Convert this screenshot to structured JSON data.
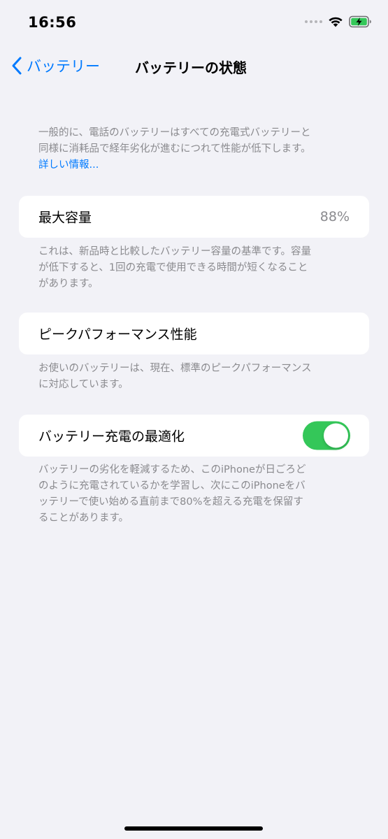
{
  "status_bar": {
    "time": "16:56",
    "battery_color": "#34c759"
  },
  "nav": {
    "back_label": "バッテリー",
    "title": "バッテリーの状態"
  },
  "intro": {
    "text_line1": "一般的に、電話のバッテリーはすべての充電式バッテリーと",
    "text_line2": "同様に消耗品で経年劣化が進むにつれて性能が低下します。",
    "link": "詳しい情報..."
  },
  "max_capacity": {
    "label": "最大容量",
    "value": "88%",
    "footnote_line1": "これは、新品時と比較したバッテリー容量の基準です。容量",
    "footnote_line2": "が低下すると、1回の充電で使用できる時間が短くなること",
    "footnote_line3": "があります。"
  },
  "peak_performance": {
    "label": "ピークパフォーマンス性能",
    "footnote_line1": "お使いのバッテリーは、現在、標準のピークパフォーマンス",
    "footnote_line2": "に対応しています。"
  },
  "optimized_charging": {
    "label": "バッテリー充電の最適化",
    "enabled": true,
    "toggle_color": "#34c759",
    "footnote_line1": "バッテリーの劣化を軽減するため、このiPhoneが日ごろど",
    "footnote_line2": "のように充電されているかを学習し、次にこのiPhoneをバ",
    "footnote_line3": "ッテリーで使い始める直前まで80%を超える充電を保留す",
    "footnote_line4": "ることがあります。"
  },
  "colors": {
    "accent": "#007aff",
    "background": "#f2f2f7",
    "secondary_text": "#8a8a8e"
  }
}
